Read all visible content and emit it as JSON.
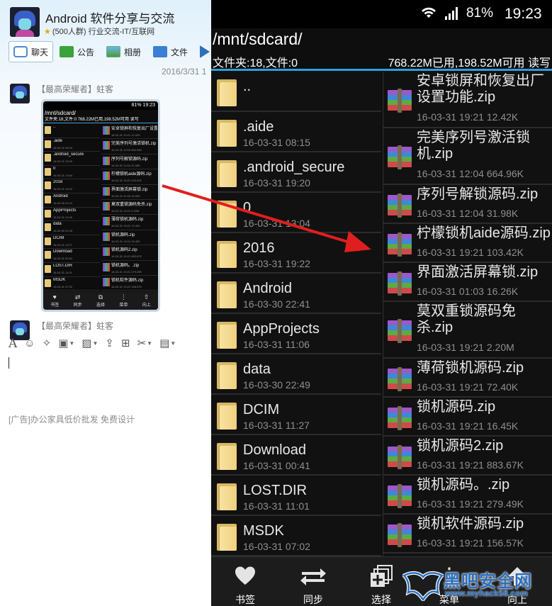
{
  "qq": {
    "group_title": "Android  软件分享与交流",
    "group_meta": "(500人群) 行业交流-IT/互联网",
    "tabs": [
      {
        "label": "聊天",
        "icon": "chat-icon"
      },
      {
        "label": "公告",
        "icon": "notice-icon"
      },
      {
        "label": "相册",
        "icon": "album-icon"
      },
      {
        "label": "文件",
        "icon": "file-icon"
      }
    ],
    "date": "2016/3/31 1",
    "messages": [
      {
        "sender": "【最高荣耀者】蛀客"
      },
      {
        "sender": "【最高荣耀者】蛀客"
      }
    ],
    "ad_text": "[广告]办公家具低价批发 免费设计"
  },
  "thumb": {
    "status": "81%  19:23",
    "path": "/mnt/sdcard/",
    "info": "文件夹:18,文件:0        768.22M已用,198.52M可用  读写",
    "folders": [
      {
        "name": "..",
        "meta": ""
      },
      {
        "name": ".aide",
        "meta": "16-03-31 08:15"
      },
      {
        "name": ".android_secure",
        "meta": "16-03-31 19:20"
      },
      {
        "name": "0",
        "meta": "16-03-31 13:04"
      },
      {
        "name": "2016",
        "meta": "16-03-31 19:22"
      },
      {
        "name": "Android",
        "meta": "16-03-30 22:41"
      },
      {
        "name": "AppProjects",
        "meta": "16-03-31 11:06"
      },
      {
        "name": "data",
        "meta": "16-03-30 22:49"
      },
      {
        "name": "DCIM",
        "meta": "16-03-31 11:27"
      },
      {
        "name": "Download",
        "meta": "16-03-31 00:41"
      },
      {
        "name": "LOST.DIR",
        "meta": "16-03-31 11:01"
      },
      {
        "name": "MSDK",
        "meta": "16-03-31 07:02"
      }
    ],
    "files": [
      {
        "name": "安卓锁屏和恢复出厂设置功能.zip",
        "meta": "16-03-31 19:21  12.42K"
      },
      {
        "name": "完美序列号激活锁机.zip",
        "meta": "16-03-31 12:04  664.96K"
      },
      {
        "name": "序列号解锁源码.zip",
        "meta": "16-03-31 12:04  31.98K"
      },
      {
        "name": "柠檬锁机aide源码.zip",
        "meta": "16-03-31 19:21  103.42K"
      },
      {
        "name": "界面激活屏幕锁.zip",
        "meta": "16-03-31 01:03  16.26K"
      },
      {
        "name": "莫双重锁源码免杀.zip",
        "meta": "16-03-31 19:21  2.20M"
      },
      {
        "name": "薄荷锁机源码.zip",
        "meta": "16-03-31 19:21  72.40K"
      },
      {
        "name": "锁机源码.zip",
        "meta": "16-03-31 19:21  16.45K"
      },
      {
        "name": "锁机源码2.zip",
        "meta": "16-03-31 19:21  883.67K"
      },
      {
        "name": "锁机源码。.zip",
        "meta": "16-03-31 19:21  279.49K"
      },
      {
        "name": "锁机软件源码.zip",
        "meta": "16-03-31 19:21  156.57K"
      }
    ],
    "buttons": [
      "书签",
      "同步",
      "选择",
      "菜单",
      "向上"
    ]
  },
  "phone": {
    "battery": "81%",
    "time": "19:23",
    "path": "/mnt/sdcard/",
    "info_left": "文件夹:18,文件:0",
    "info_right": "768.22M已用,198.52M可用  读写",
    "folders": [
      {
        "name": "..",
        "meta": ""
      },
      {
        "name": ".aide",
        "meta": "16-03-31 08:15"
      },
      {
        "name": ".android_secure",
        "meta": "16-03-31 19:20"
      },
      {
        "name": "0",
        "meta": "16-03-31 13:04"
      },
      {
        "name": "2016",
        "meta": "16-03-31 19:22"
      },
      {
        "name": "Android",
        "meta": "16-03-30 22:41"
      },
      {
        "name": "AppProjects",
        "meta": "16-03-31 11:06"
      },
      {
        "name": "data",
        "meta": "16-03-30 22:49"
      },
      {
        "name": "DCIM",
        "meta": "16-03-31 11:27"
      },
      {
        "name": "Download",
        "meta": "16-03-31 00:41"
      },
      {
        "name": "LOST.DIR",
        "meta": "16-03-31 11:01"
      },
      {
        "name": "MSDK",
        "meta": "16-03-31 07:02"
      }
    ],
    "files": [
      {
        "name": "安卓锁屏和恢复出厂设置功能.zip",
        "meta": "16-03-31 19:21  12.42K"
      },
      {
        "name": "完美序列号激活锁机.zip",
        "meta": "16-03-31 12:04  664.96K"
      },
      {
        "name": "序列号解锁源码.zip",
        "meta": "16-03-31 12:04  31.98K"
      },
      {
        "name": "柠檬锁机aide源码.zip",
        "meta": "16-03-31 19:21  103.42K"
      },
      {
        "name": "界面激活屏幕锁.zip",
        "meta": "16-03-31 01:03  16.26K"
      },
      {
        "name": "莫双重锁源码免杀.zip",
        "meta": "16-03-31 19:21  2.20M"
      },
      {
        "name": "薄荷锁机源码.zip",
        "meta": "16-03-31 19:21  72.40K"
      },
      {
        "name": "锁机源码.zip",
        "meta": "16-03-31 19:21  16.45K"
      },
      {
        "name": "锁机源码2.zip",
        "meta": "16-03-31 19:21  883.67K"
      },
      {
        "name": "锁机源码。.zip",
        "meta": "16-03-31 19:21  279.49K"
      },
      {
        "name": "锁机软件源码.zip",
        "meta": "16-03-31 19:21  156.57K"
      }
    ],
    "buttons": [
      {
        "label": "书签",
        "icon": "heart-icon"
      },
      {
        "label": "同步",
        "icon": "sync-arrows-icon"
      },
      {
        "label": "选择",
        "icon": "select-icon"
      },
      {
        "label": "菜单",
        "icon": "menu-icon"
      },
      {
        "label": "向上",
        "icon": "up-arrow-icon"
      }
    ]
  },
  "watermark": {
    "text": "黑吧安全网",
    "url": "www.myhack58.com"
  },
  "colors": {
    "accent": "#2ea0dc",
    "arrow": "#e11e1e",
    "phone_bg": "#0e0e0e"
  }
}
